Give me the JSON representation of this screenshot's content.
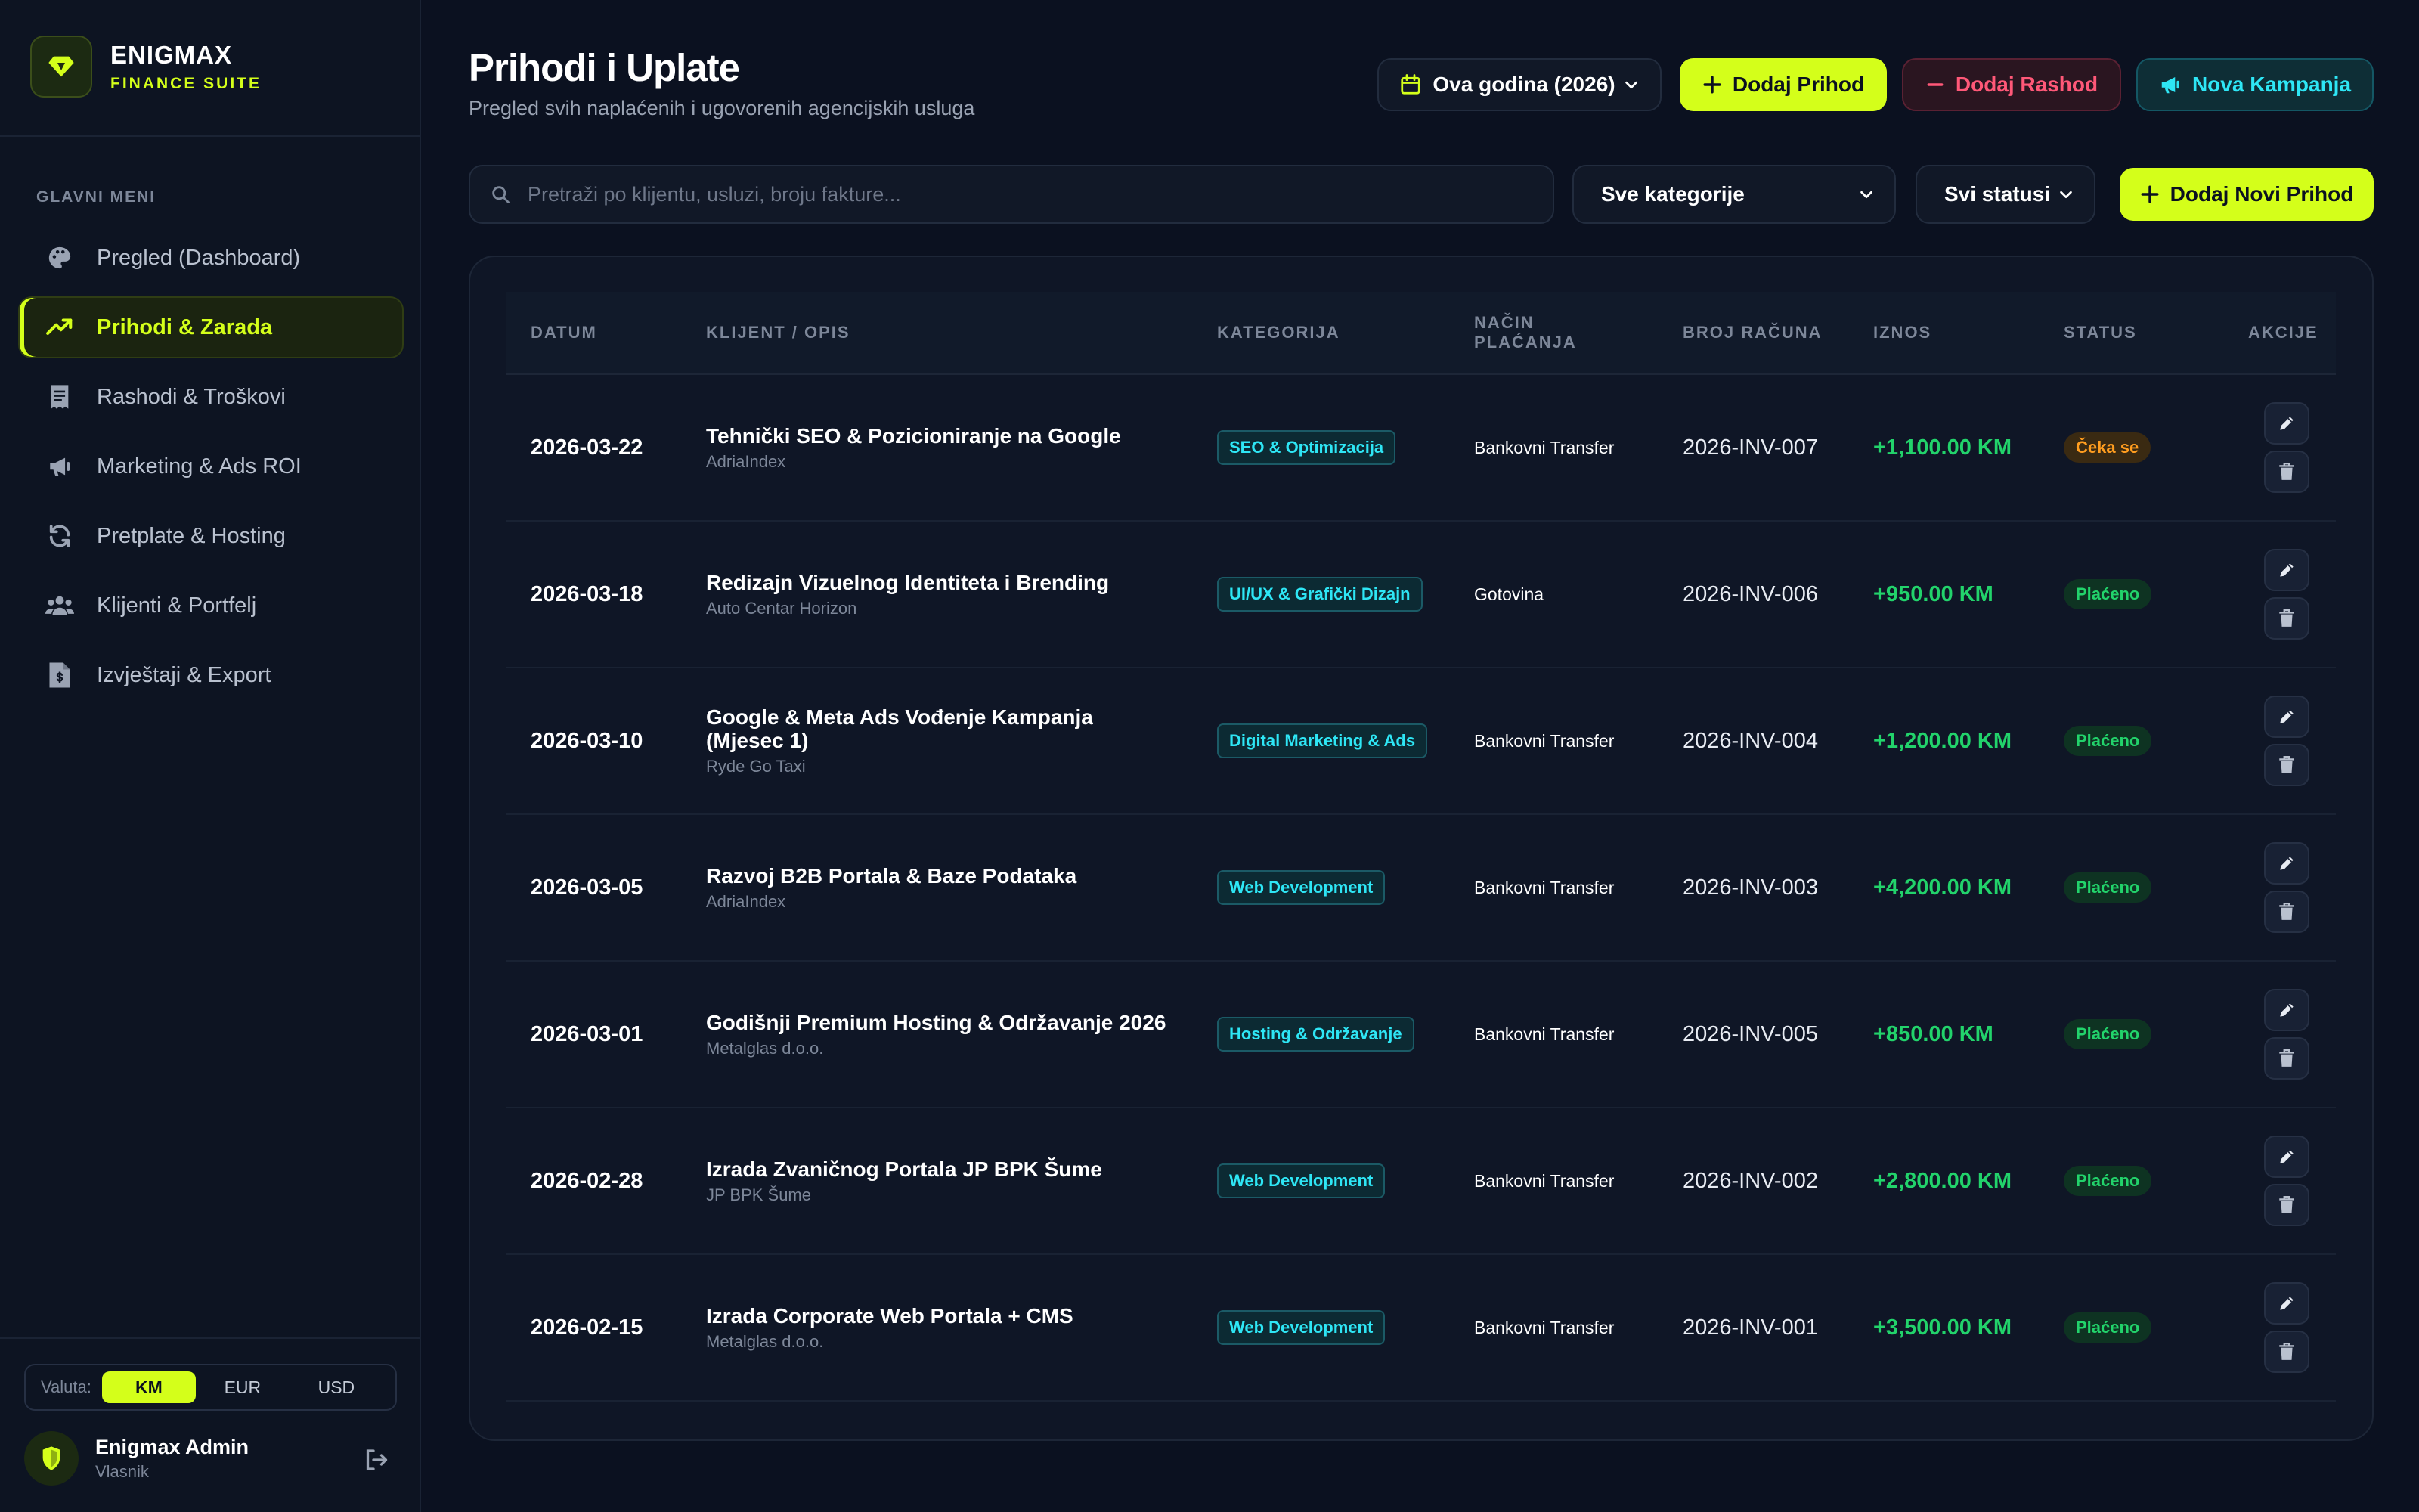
{
  "brand": {
    "name": "ENIGMAX",
    "subtitle": "FINANCE SUITE",
    "icon": "diamond-icon"
  },
  "colors": {
    "accent": "#d4ff1a",
    "danger": "#ff5878",
    "cyan": "#2ee6f5",
    "success": "#22d36b",
    "warning": "#ff9d1f",
    "background": "#0b1120"
  },
  "sidebar": {
    "menu_title": "GLAVNI MENI",
    "items": [
      {
        "label": "Pregled (Dashboard)",
        "icon": "palette-icon",
        "active": false
      },
      {
        "label": "Prihodi & Zarada",
        "icon": "trending-up-icon",
        "active": true
      },
      {
        "label": "Rashodi & Troškovi",
        "icon": "receipt-icon",
        "active": false
      },
      {
        "label": "Marketing & Ads ROI",
        "icon": "megaphone-icon",
        "active": false
      },
      {
        "label": "Pretplate & Hosting",
        "icon": "refresh-icon",
        "active": false
      },
      {
        "label": "Klijenti & Portfelj",
        "icon": "users-icon",
        "active": false
      },
      {
        "label": "Izvještaji & Export",
        "icon": "file-dollar-icon",
        "active": false
      }
    ],
    "currency": {
      "label": "Valuta:",
      "options": [
        "KM",
        "EUR",
        "USD"
      ],
      "selected": "KM"
    },
    "user": {
      "name": "Enigmax Admin",
      "role": "Vlasnik",
      "icon": "shield-icon"
    }
  },
  "header": {
    "title": "Prihodi i Uplate",
    "subtitle": "Pregled svih naplaćenih i ugovorenih agencijskih usluga",
    "year_filter": "Ova godina (2026)",
    "add_income": "Dodaj Prihod",
    "add_expense": "Dodaj Rashod",
    "new_campaign": "Nova Kampanja"
  },
  "filters": {
    "search_placeholder": "Pretraži po klijentu, usluzi, broju fakture...",
    "category": "Sve kategorije",
    "status": "Svi statusi",
    "add_new": "Dodaj Novi Prihod"
  },
  "table": {
    "columns": {
      "date": "DATUM",
      "client": "KLIJENT / OPIS",
      "category": "KATEGORIJA",
      "method": "NAČIN PLAĆANJA",
      "invoice": "BROJ RAČUNA",
      "amount": "IZNOS",
      "status": "STATUS",
      "actions": "AKCIJE"
    },
    "rows": [
      {
        "date": "2026-03-22",
        "title": "Tehnički SEO & Pozicioniranje na Google",
        "client": "AdriaIndex",
        "category": "SEO & Optimizacija",
        "method": "Bankovni Transfer",
        "invoice": "2026-INV-007",
        "amount": "+1,100.00 KM",
        "status": "Čeka se",
        "status_type": "wait"
      },
      {
        "date": "2026-03-18",
        "title": "Redizajn Vizuelnog Identiteta i Brending",
        "client": "Auto Centar Horizon",
        "category": "UI/UX & Grafički Dizajn",
        "method": "Gotovina",
        "invoice": "2026-INV-006",
        "amount": "+950.00 KM",
        "status": "Plaćeno",
        "status_type": "paid"
      },
      {
        "date": "2026-03-10",
        "title": "Google & Meta Ads Vođenje Kampanja (Mjesec 1)",
        "client": "Ryde Go Taxi",
        "category": "Digital Marketing & Ads",
        "method": "Bankovni Transfer",
        "invoice": "2026-INV-004",
        "amount": "+1,200.00 KM",
        "status": "Plaćeno",
        "status_type": "paid"
      },
      {
        "date": "2026-03-05",
        "title": "Razvoj B2B Portala & Baze Podataka",
        "client": "AdriaIndex",
        "category": "Web Development",
        "method": "Bankovni Transfer",
        "invoice": "2026-INV-003",
        "amount": "+4,200.00 KM",
        "status": "Plaćeno",
        "status_type": "paid"
      },
      {
        "date": "2026-03-01",
        "title": "Godišnji Premium Hosting & Održavanje 2026",
        "client": "Metalglas d.o.o.",
        "category": "Hosting & Održavanje",
        "method": "Bankovni Transfer",
        "invoice": "2026-INV-005",
        "amount": "+850.00 KM",
        "status": "Plaćeno",
        "status_type": "paid"
      },
      {
        "date": "2026-02-28",
        "title": "Izrada Zvaničnog Portala JP BPK Šume",
        "client": "JP BPK Šume",
        "category": "Web Development",
        "method": "Bankovni Transfer",
        "invoice": "2026-INV-002",
        "amount": "+2,800.00 KM",
        "status": "Plaćeno",
        "status_type": "paid"
      },
      {
        "date": "2026-02-15",
        "title": "Izrada Corporate Web Portala + CMS",
        "client": "Metalglas d.o.o.",
        "category": "Web Development",
        "method": "Bankovni Transfer",
        "invoice": "2026-INV-001",
        "amount": "+3,500.00 KM",
        "status": "Plaćeno",
        "status_type": "paid"
      }
    ]
  }
}
